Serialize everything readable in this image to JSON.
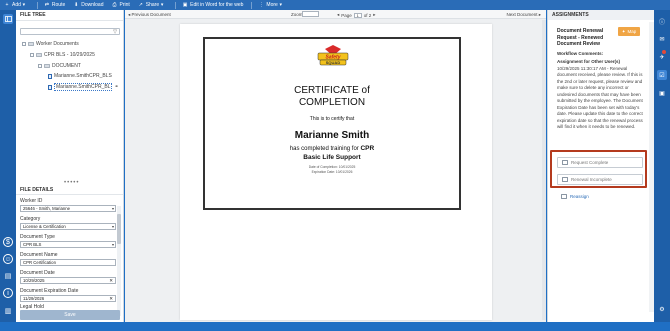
{
  "toolbar": {
    "add": "Add",
    "route": "Route",
    "download": "Download",
    "print": "Print",
    "share": "Share",
    "edit_word": "Edit in Word for the web",
    "more": "More"
  },
  "file_tree": {
    "heading": "FILE TREE",
    "items": [
      "Worker Documents",
      "CPR BLS - 10/29/2025",
      "DOCUMENT",
      "Marianne.SmithCPR_BLS",
      "Marianne.SmithCPR_BL"
    ]
  },
  "file_details": {
    "heading": "FILE DETAILS",
    "worker_id_label": "Worker ID",
    "worker_id_value": "25646 - Smith, Marianne",
    "category_label": "Category",
    "category_value": "License & Certification",
    "doc_type_label": "Document Type",
    "doc_type_value": "CPR BLS",
    "doc_name_label": "Document Name",
    "doc_name_value": "CPR Certification",
    "doc_date_label": "Document Date",
    "doc_date_value": "10/29/2025",
    "exp_date_label": "Document Expiration Date",
    "exp_date_value": "11/29/2026",
    "legal_hold_label": "Legal Hold",
    "save_label": "Save"
  },
  "viewer": {
    "prev": "Previous Document",
    "next": "Next Document",
    "zoom_label": "Zoom",
    "page_label": "Page",
    "page_value": "1",
    "page_of": "of 2"
  },
  "certificate": {
    "logo_text": "Safety Squad",
    "title_line1": "CERTIFICATE of",
    "title_line2": "COMPLETION",
    "certify": "This is to certify that",
    "name": "Marianne Smith",
    "completed": "has completed training for ",
    "course_1": "CPR",
    "course_2": "Basic Life Support",
    "completion_date": "Date of Completion: 10/01/2025",
    "expiration_date": "Expiration Date: 10/01/2026"
  },
  "assignments": {
    "heading": "ASSIGNMENTS",
    "title": "Document Renewal Request - Renewed Document Review",
    "map_button": "Map",
    "workflow_heading": "Workflow Comments:",
    "assigned_to": "Assignment for Other User(s)",
    "comment": "10/29/2025 11:30:17 AM - Renewal document received, please review. If this is the 2nd or later request, please review and make sure to delete any incorrect or undesired documents that may have been submitted by the employee. The Document Expiration Date has been set with today's date. Please update this date to the correct expiration date so that the renewal process will find it when it needs to be renewed.",
    "request_complete": "Request Complete",
    "renewal_incomplete": "Renewal Incomplete",
    "reassign": "Reassign"
  },
  "colors": {
    "chrome_blue": "#1f6fc4",
    "toolbar_blue": "#2a6cb7",
    "map_orange": "#f0a545",
    "highlight_red": "#b43a1e",
    "badge_red": "#e04a3a"
  },
  "badge_count": "1"
}
